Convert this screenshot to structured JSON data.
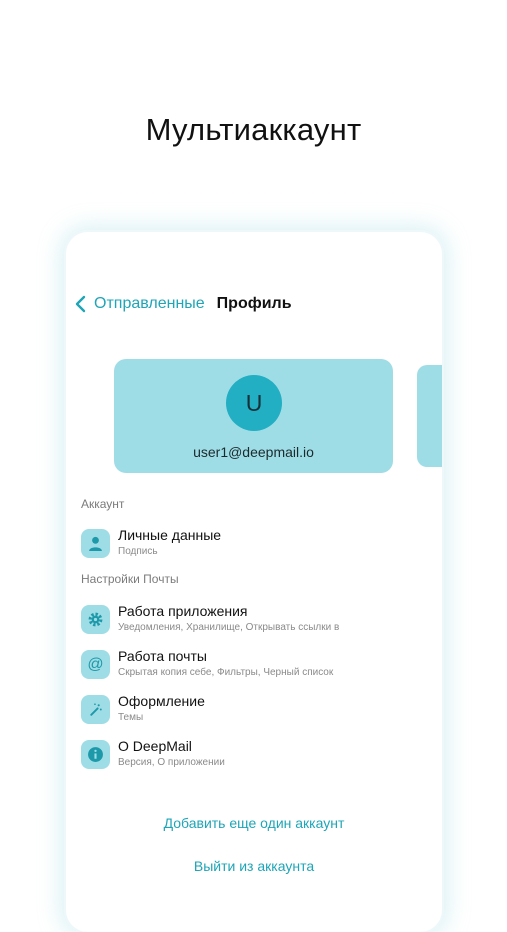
{
  "heading": "Мультиаккаунт",
  "nav": {
    "back_label": "Отправленные",
    "title": "Профиль"
  },
  "account_card": {
    "avatar_letter": "U",
    "email": "user1@deepmail.io"
  },
  "sections": {
    "account": {
      "title": "Аккаунт",
      "items": [
        {
          "title": "Личные данные",
          "subtitle": "Подпись",
          "icon": "person-icon"
        }
      ]
    },
    "mail_settings": {
      "title": "Настройки Почты",
      "items": [
        {
          "title": "Работа приложения",
          "subtitle": "Уведомления, Хранилище, Открывать ссылки в",
          "icon": "gear-icon"
        },
        {
          "title": "Работа почты",
          "subtitle": "Скрытая копия себе, Фильтры, Черный список",
          "icon": "at-icon"
        },
        {
          "title": "Оформление",
          "subtitle": "Темы",
          "icon": "magic-wand-icon"
        },
        {
          "title": "О DeepMail",
          "subtitle": "Версия, О приложении",
          "icon": "info-icon"
        }
      ]
    }
  },
  "actions": {
    "add_account": "Добавить еще один аккаунт",
    "logout": "Выйти из аккаунта"
  },
  "colors": {
    "accent": "#1ea5b7",
    "card": "#9fdde6",
    "avatar": "#22aec3"
  }
}
